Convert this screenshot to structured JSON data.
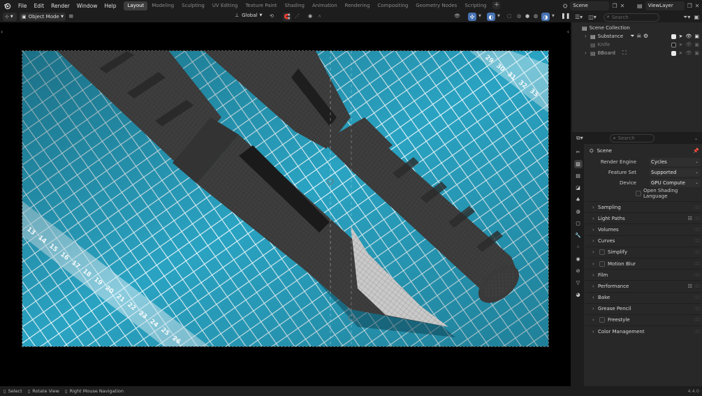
{
  "menu": [
    "File",
    "Edit",
    "Render",
    "Window",
    "Help"
  ],
  "workspaces": [
    "Layout",
    "Modeling",
    "Sculpting",
    "UV Editing",
    "Texture Paint",
    "Shading",
    "Animation",
    "Rendering",
    "Compositing",
    "Geometry Nodes",
    "Scripting"
  ],
  "active_workspace": "Layout",
  "scene_name": "Scene",
  "view_layer": "ViewLayer",
  "viewport": {
    "mode": "Object Mode",
    "orientation": "Global"
  },
  "outliner": {
    "search_placeholder": "Search",
    "root": "Scene Collection",
    "items": [
      {
        "label": "Substance",
        "visible": true
      },
      {
        "label": "Knife",
        "visible": false
      },
      {
        "label": "BBoard",
        "visible": true
      }
    ]
  },
  "properties": {
    "search_placeholder": "Search",
    "context_title": "Scene",
    "fields": [
      {
        "label": "Render Engine",
        "value": "Cycles"
      },
      {
        "label": "Feature Set",
        "value": "Supported"
      },
      {
        "label": "Device",
        "value": "GPU Compute"
      }
    ],
    "osl_label": "Open Shading Language",
    "sections": [
      {
        "label": "Sampling",
        "checkbox": false,
        "list": false
      },
      {
        "label": "Light Paths",
        "checkbox": false,
        "list": true
      },
      {
        "label": "Volumes",
        "checkbox": false,
        "list": false
      },
      {
        "label": "Curves",
        "checkbox": false,
        "list": false
      },
      {
        "label": "Simplify",
        "checkbox": true,
        "list": false
      },
      {
        "label": "Motion Blur",
        "checkbox": true,
        "list": false
      },
      {
        "label": "Film",
        "checkbox": false,
        "list": false
      },
      {
        "label": "Performance",
        "checkbox": false,
        "list": true
      },
      {
        "label": "Bake",
        "checkbox": false,
        "list": false
      },
      {
        "label": "Grease Pencil",
        "checkbox": false,
        "list": false
      },
      {
        "label": "Freestyle",
        "checkbox": true,
        "list": false
      },
      {
        "label": "Color Management",
        "checkbox": false,
        "list": false
      }
    ]
  },
  "status": {
    "select": "Select",
    "rotate": "Rotate View",
    "nav": "Right Mouse Navigation",
    "version": "4.4.0"
  },
  "mat_numbers_left": [
    "13",
    "14",
    "15",
    "16",
    "17",
    "18",
    "19",
    "20",
    "21",
    "22",
    "23",
    "24",
    "25",
    "26"
  ],
  "mat_numbers_right": [
    "29",
    "30",
    "31",
    "32",
    "33"
  ],
  "colors": {
    "accent": "#4772b3",
    "mat": "#2aa3c2",
    "panel": "#282828",
    "header": "#1d1d1d"
  }
}
